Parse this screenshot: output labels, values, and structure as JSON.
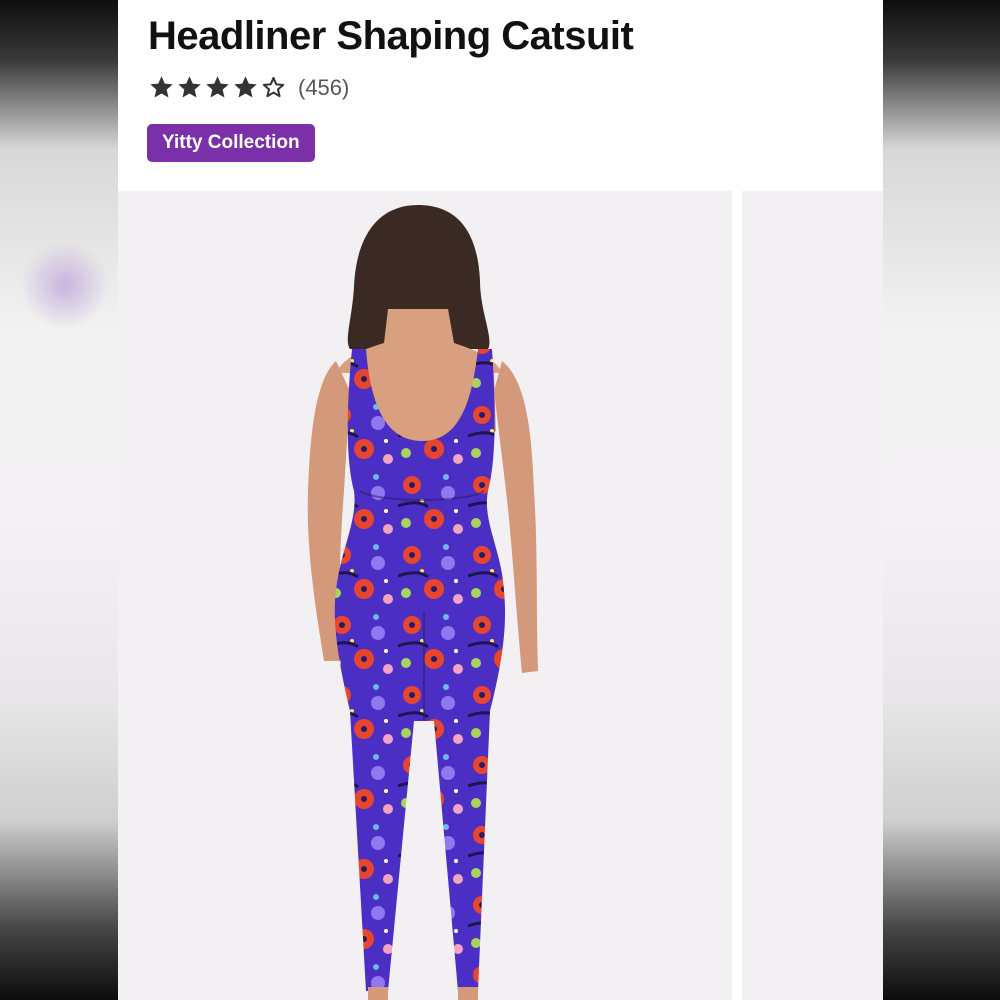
{
  "product": {
    "title": "Headliner Shaping Catsuit",
    "rating": {
      "stars": 4,
      "max": 5,
      "count": "(456)"
    },
    "collection_badge": "Yitty Collection"
  },
  "colors": {
    "badge": "#7b2fa8",
    "star": "#333333",
    "print_base": "#4b2fc4"
  },
  "gallery": {
    "images": [
      {
        "icon": "model-back-view-photo"
      },
      {
        "icon": "next-photo-preview"
      }
    ]
  }
}
